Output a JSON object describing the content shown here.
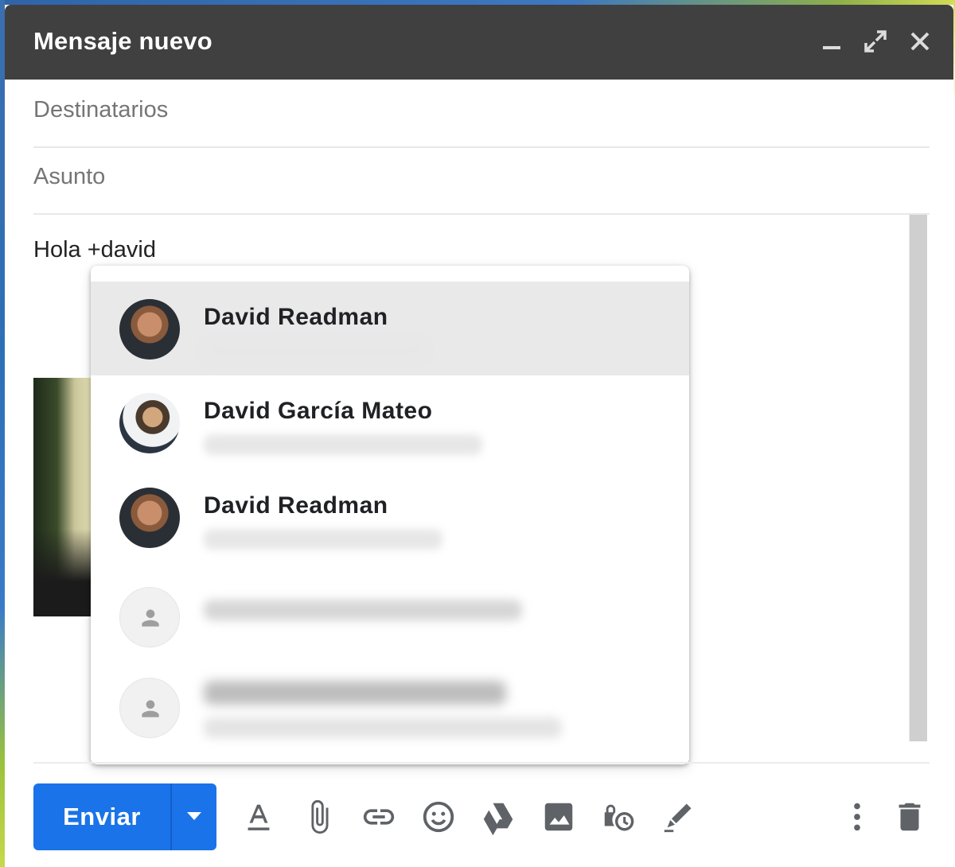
{
  "window": {
    "title": "Mensaje nuevo",
    "controls": [
      "minimize-icon",
      "expand-icon",
      "close-icon"
    ],
    "header_color": "#404040"
  },
  "fields": {
    "recipients_placeholder": "Destinatarios",
    "subject_placeholder": "Asunto"
  },
  "body": {
    "text": "Hola +david"
  },
  "suggestions": [
    {
      "name": "David Readman",
      "avatar": "photo",
      "highlighted": true
    },
    {
      "name": "David García Mateo",
      "avatar": "photo",
      "highlighted": false
    },
    {
      "name": "David Readman",
      "avatar": "photo",
      "highlighted": false
    },
    {
      "name": "",
      "avatar": "person-icon",
      "highlighted": false
    },
    {
      "name": "",
      "avatar": "person-icon",
      "highlighted": false
    }
  ],
  "toolbar": {
    "send_label": "Enviar",
    "send_color": "#1a73e8",
    "tools": [
      "formatting-icon",
      "attach-icon",
      "link-icon",
      "emoji-icon",
      "drive-icon",
      "photo-icon",
      "confidential-mode-icon",
      "signature-icon",
      "more-options-icon",
      "discard-icon"
    ]
  }
}
